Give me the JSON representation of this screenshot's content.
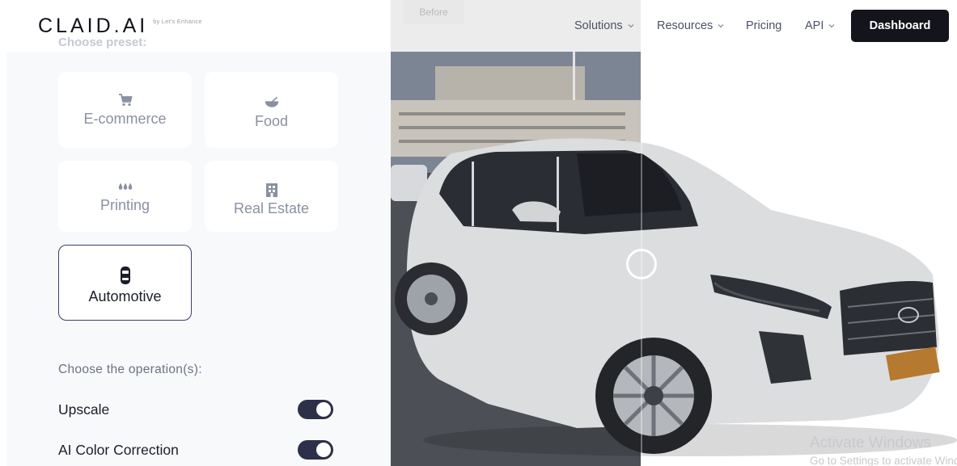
{
  "header": {
    "logo": "CLAID.AI",
    "logo_sub": "by Let's Enhance",
    "nav": [
      {
        "label": "Solutions",
        "has_dropdown": true
      },
      {
        "label": "Resources",
        "has_dropdown": true
      },
      {
        "label": "Pricing",
        "has_dropdown": false
      },
      {
        "label": "API",
        "has_dropdown": true
      }
    ],
    "dashboard_label": "Dashboard"
  },
  "panel": {
    "faded_label": "Choose preset:",
    "presets": [
      {
        "label": "E-commerce",
        "icon": "cart-icon",
        "active": false
      },
      {
        "label": "Food",
        "icon": "bowl-icon",
        "active": false
      },
      {
        "label": "Printing",
        "icon": "ink-drops-icon",
        "active": false
      },
      {
        "label": "Real Estate",
        "icon": "building-icon",
        "active": false
      },
      {
        "label": "Automotive",
        "icon": "car-icon",
        "active": true
      }
    ],
    "ops_label": "Choose the operation(s):",
    "operations": [
      {
        "label": "Upscale",
        "enabled": true
      },
      {
        "label": "AI Color Correction",
        "enabled": true
      }
    ]
  },
  "compare": {
    "before_label": "Before"
  },
  "watermark": {
    "title": "Activate Windows",
    "subtitle": "Go to Settings to activate Windows."
  },
  "colors": {
    "accent": "#14151c",
    "panel_bg": "#f8f9fb",
    "toggle_on": "#2c3048",
    "active_border": "#3b3f6e"
  }
}
